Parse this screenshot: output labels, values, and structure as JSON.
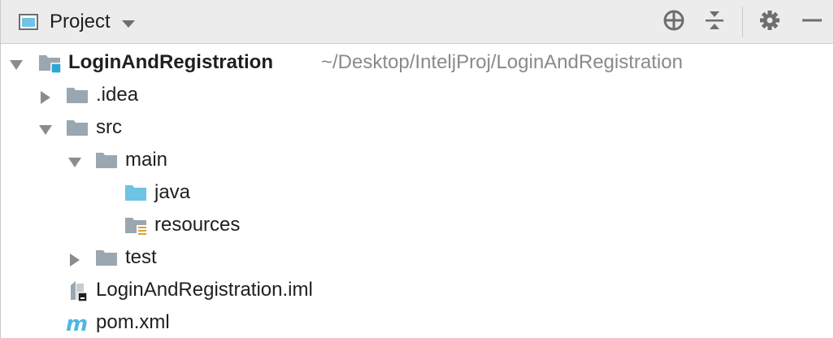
{
  "toolbar": {
    "view_title": "Project",
    "locate_icon": "crosshair-icon",
    "collapse_icon": "collapse-all-icon",
    "settings_icon": "gear-icon",
    "hide_icon": "minimize-icon"
  },
  "colors": {
    "toolbar_bg": "#ececec",
    "folder_gray": "#9aa7b0",
    "folder_source": "#6fc3e3",
    "module_marker": "#2aa7d6",
    "path_gray": "#8a8a8a",
    "maven_blue": "#4fb6e4"
  },
  "tree": {
    "root": {
      "label": "LoginAndRegistration",
      "path": "~/Desktop/InteljProj/LoginAndRegistration",
      "icon": "module-folder-icon",
      "expanded": true
    },
    "items": [
      {
        "label": ".idea",
        "icon": "folder-icon",
        "expanded": false
      },
      {
        "label": "src",
        "icon": "folder-icon",
        "expanded": true
      },
      {
        "label": "main",
        "icon": "folder-icon",
        "expanded": true
      },
      {
        "label": "java",
        "icon": "source-folder-icon"
      },
      {
        "label": "resources",
        "icon": "resources-folder-icon"
      },
      {
        "label": "test",
        "icon": "folder-icon",
        "expanded": false
      },
      {
        "label": "LoginAndRegistration.iml",
        "icon": "module-file-icon"
      },
      {
        "label": "pom.xml",
        "icon": "maven-icon"
      }
    ]
  }
}
